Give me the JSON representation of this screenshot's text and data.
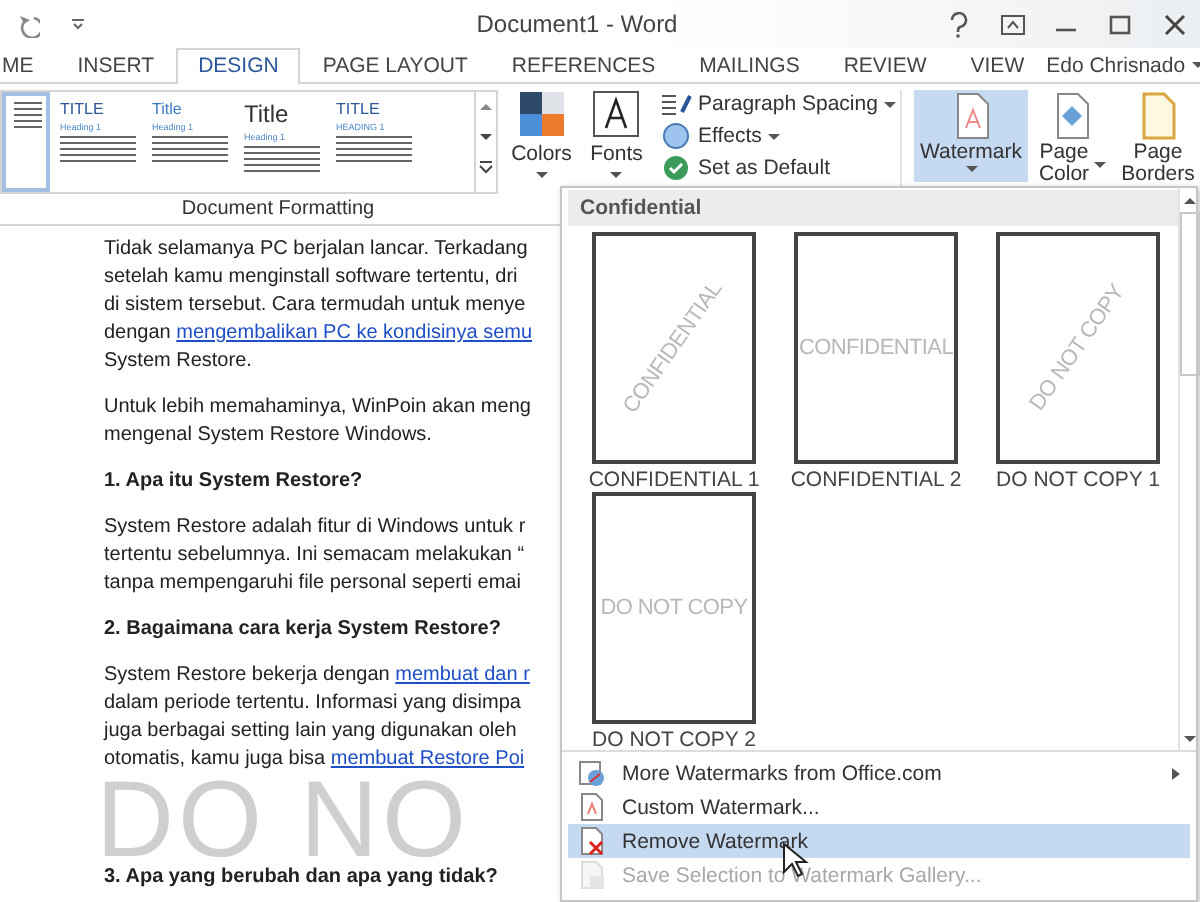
{
  "window": {
    "title": "Document1 - Word",
    "user": "Edo Chrisnado"
  },
  "tabs": [
    {
      "label": "ME",
      "selected": false
    },
    {
      "label": "INSERT",
      "selected": false
    },
    {
      "label": "DESIGN",
      "selected": true
    },
    {
      "label": "PAGE LAYOUT",
      "selected": false
    },
    {
      "label": "REFERENCES",
      "selected": false
    },
    {
      "label": "MAILINGS",
      "selected": false
    },
    {
      "label": "REVIEW",
      "selected": false
    },
    {
      "label": "VIEW",
      "selected": false
    }
  ],
  "ribbon": {
    "style_gallery": [
      {
        "selected": true
      },
      {
        "title": "TITLE",
        "heading": "Heading 1",
        "kind": "small",
        "selected": false
      },
      {
        "title": "Title",
        "heading": "Heading 1",
        "kind": "accent",
        "selected": false
      },
      {
        "title": "Title",
        "heading": "Heading 1",
        "kind": "large",
        "selected": false
      },
      {
        "title": "TITLE",
        "heading": "HEADING 1",
        "kind": "small",
        "selected": false
      }
    ],
    "theme_buttons": [
      {
        "label": "Colors",
        "kind": "colors"
      },
      {
        "label": "Fonts",
        "kind": "fonts"
      }
    ],
    "options": [
      {
        "label": "Paragraph Spacing",
        "kind": "spacing",
        "dropdown": true
      },
      {
        "label": "Effects",
        "kind": "effects",
        "dropdown": true
      },
      {
        "label": "Set as Default",
        "kind": "default",
        "dropdown": false
      }
    ],
    "group_label": "Document Formatting",
    "page_background": [
      {
        "label": "Watermark",
        "kind": "watermark",
        "selected": true
      },
      {
        "label": "Page Color",
        "kind": "color",
        "selected": false
      },
      {
        "label": "Page Borders",
        "kind": "borders",
        "selected": false
      }
    ]
  },
  "document": {
    "watermark": "DO NO",
    "blocks": [
      {
        "kind": "text",
        "lines": [
          {
            "text": "Tidak selamanya PC berjalan lancar. Terkadang"
          },
          {
            "text": "setelah kamu menginstall software tertentu, dri"
          },
          {
            "text": "di sistem tersebut. Cara termudah untuk menye"
          },
          {
            "text": "dengan ",
            "link": "mengembalikan PC ke kondisinya semu"
          },
          {
            "text": "System Restore."
          }
        ]
      },
      {
        "kind": "text",
        "lines": [
          {
            "text": "Untuk lebih memahaminya, WinPoin akan meng"
          },
          {
            "text": "mengenal System Restore Windows."
          }
        ]
      },
      {
        "kind": "heading",
        "lines": [
          {
            "text": "1. Apa itu System Restore?"
          }
        ]
      },
      {
        "kind": "text",
        "lines": [
          {
            "text": "System Restore adalah fitur di Windows untuk r"
          },
          {
            "text": "tertentu sebelumnya. Ini semacam melakukan “"
          },
          {
            "text": "tanpa mempengaruhi file personal seperti emai"
          }
        ]
      },
      {
        "kind": "heading",
        "lines": [
          {
            "text": "2. Bagaimana cara kerja System Restore?"
          }
        ]
      },
      {
        "kind": "text",
        "lines": [
          {
            "text": "System Restore bekerja dengan ",
            "link": "membuat dan r"
          },
          {
            "text": "dalam periode tertentu. Informasi yang disimpa"
          },
          {
            "text": "juga berbagai setting lain yang digunakan oleh"
          },
          {
            "text": "otomatis, kamu juga bisa ",
            "link": "membuat Restore Poi"
          }
        ]
      },
      {
        "kind": "heading",
        "lines": [
          {
            "text": "3. Apa yang berubah dan apa yang tidak?"
          }
        ]
      }
    ]
  },
  "watermark_menu": {
    "section": "Confidential",
    "watermarks": [
      {
        "label": "CONFIDENTIAL 1",
        "text": "CONFIDENTIAL",
        "kind": "diagonal"
      },
      {
        "label": "CONFIDENTIAL 2",
        "text": "CONFIDENTIAL",
        "kind": "horizontal"
      },
      {
        "label": "DO NOT COPY 1",
        "text": "DO NOT COPY",
        "kind": "diagonal"
      },
      {
        "label": "DO NOT COPY 2",
        "text": "DO NOT COPY",
        "kind": "horizontal"
      }
    ],
    "items": [
      {
        "label": "More Watermarks from Office.com",
        "kind": "online",
        "submenu": true,
        "highlighted": false,
        "disabled": false
      },
      {
        "label": "Custom Watermark...",
        "kind": "custom",
        "submenu": false,
        "highlighted": false,
        "disabled": false
      },
      {
        "label": "Remove Watermark",
        "kind": "remove",
        "submenu": false,
        "highlighted": true,
        "disabled": false
      },
      {
        "label": "Save Selection to Watermark Gallery...",
        "kind": "save",
        "submenu": false,
        "highlighted": false,
        "disabled": true
      }
    ]
  }
}
